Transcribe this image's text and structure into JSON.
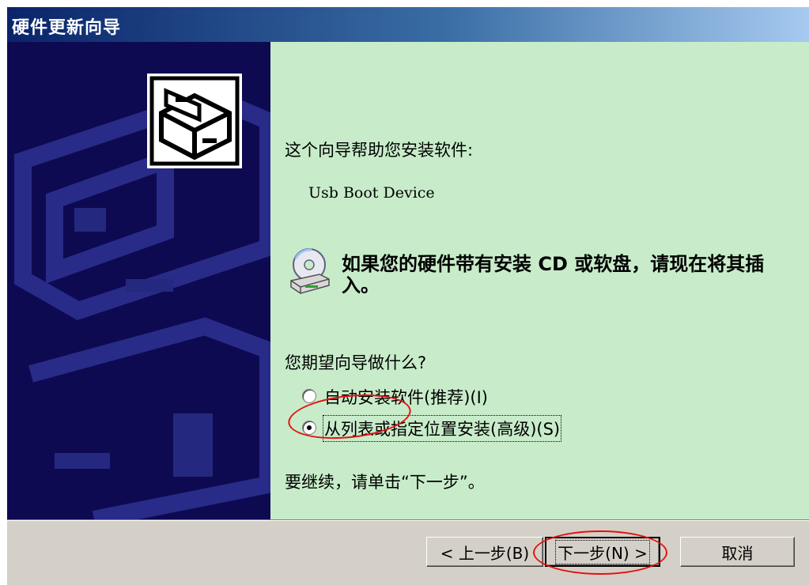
{
  "window": {
    "title": "硬件更新向导"
  },
  "content": {
    "intro": "这个向导帮助您安装软件:",
    "device_name": "Usb Boot Device",
    "cd_message": "如果您的硬件带有安装 CD 或软盘，请现在将其插入。",
    "question": "您期望向导做什么?",
    "options": [
      {
        "label": "自动安装软件(推荐)(I)",
        "selected": false
      },
      {
        "label": "从列表或指定位置安装(高级)(S)",
        "selected": true
      }
    ],
    "continue_hint": "要继续，请单击“下一步”。"
  },
  "buttons": {
    "back": "< 上一步(B)",
    "next": "下一步(N) >",
    "cancel": "取消"
  },
  "icons": {
    "wizard": "hardware-install-icon",
    "cd": "cd-drive-icon"
  },
  "colors": {
    "left_panel": "#0e0a52",
    "content_bg": "#c8ecca",
    "annotation": "#e81010"
  }
}
